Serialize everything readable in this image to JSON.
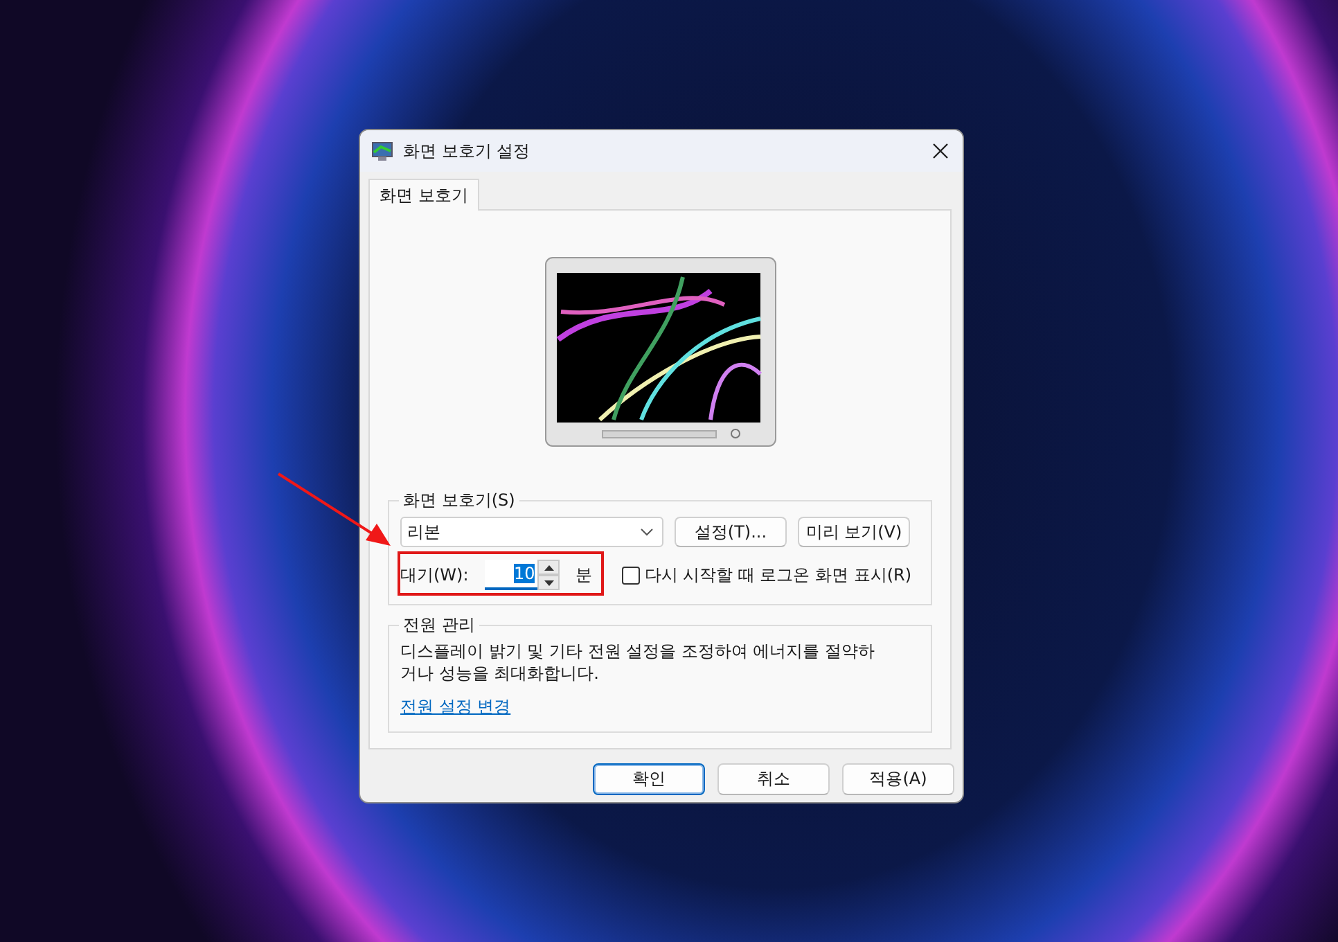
{
  "window": {
    "title": "화면 보호기 설정"
  },
  "tabs": [
    {
      "label": "화면 보호기",
      "selected": true
    }
  ],
  "screen_saver": {
    "group_label": "화면 보호기(S)",
    "selected_saver": "리본",
    "buttons": [
      "설정(T)...",
      "미리 보기(V)"
    ],
    "wait_label": "대기(W):",
    "wait_value": "10",
    "wait_value_highlighted": true,
    "wait_unit": "분",
    "logon_checkbox": {
      "label": "다시 시작할 때 로그온 화면 표시(R)",
      "checked": false
    }
  },
  "power": {
    "group_label": "전원 관리",
    "description": "디스플레이 밝기 및 기타 전원 설정을 조정하여 에너지를 절약하거나 성능을 최대화합니다.",
    "link": "전원 설정 변경"
  },
  "footer_buttons": [
    {
      "label": "확인",
      "default": true
    },
    {
      "label": "취소",
      "default": false
    },
    {
      "label": "적용(A)",
      "default": false
    }
  ]
}
